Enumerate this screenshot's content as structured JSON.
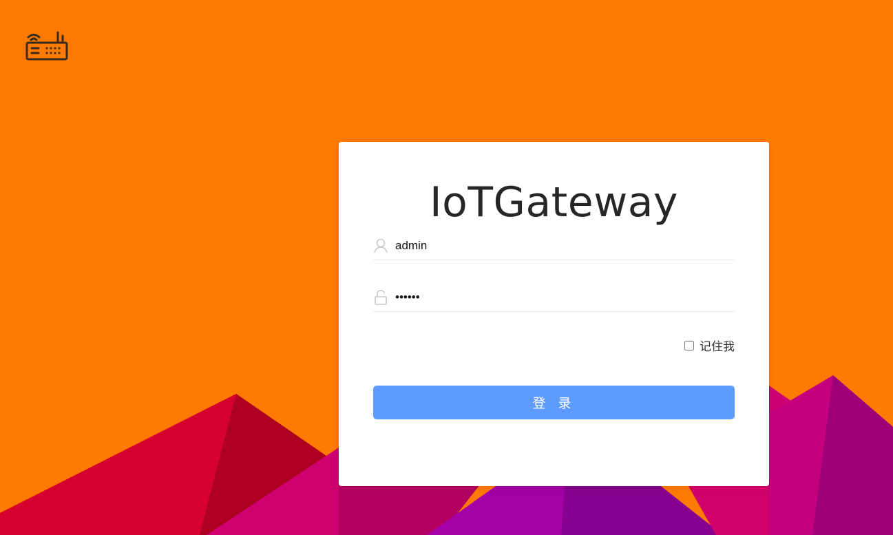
{
  "app": {
    "title": "IoTGateway",
    "logo_icon": "router-icon"
  },
  "login": {
    "username_value": "admin",
    "password_value": "••••••",
    "remember_label": "记住我",
    "remember_checked": false,
    "submit_label": "登 录",
    "username_icon": "user-icon",
    "password_icon": "lock-icon"
  },
  "colors": {
    "background": "#ff7a00",
    "card": "#ffffff",
    "button": "#5e9bff",
    "mountain_red": "#d5002e",
    "mountain_magenta": "#cc0074",
    "mountain_purple": "#9a00a0"
  }
}
